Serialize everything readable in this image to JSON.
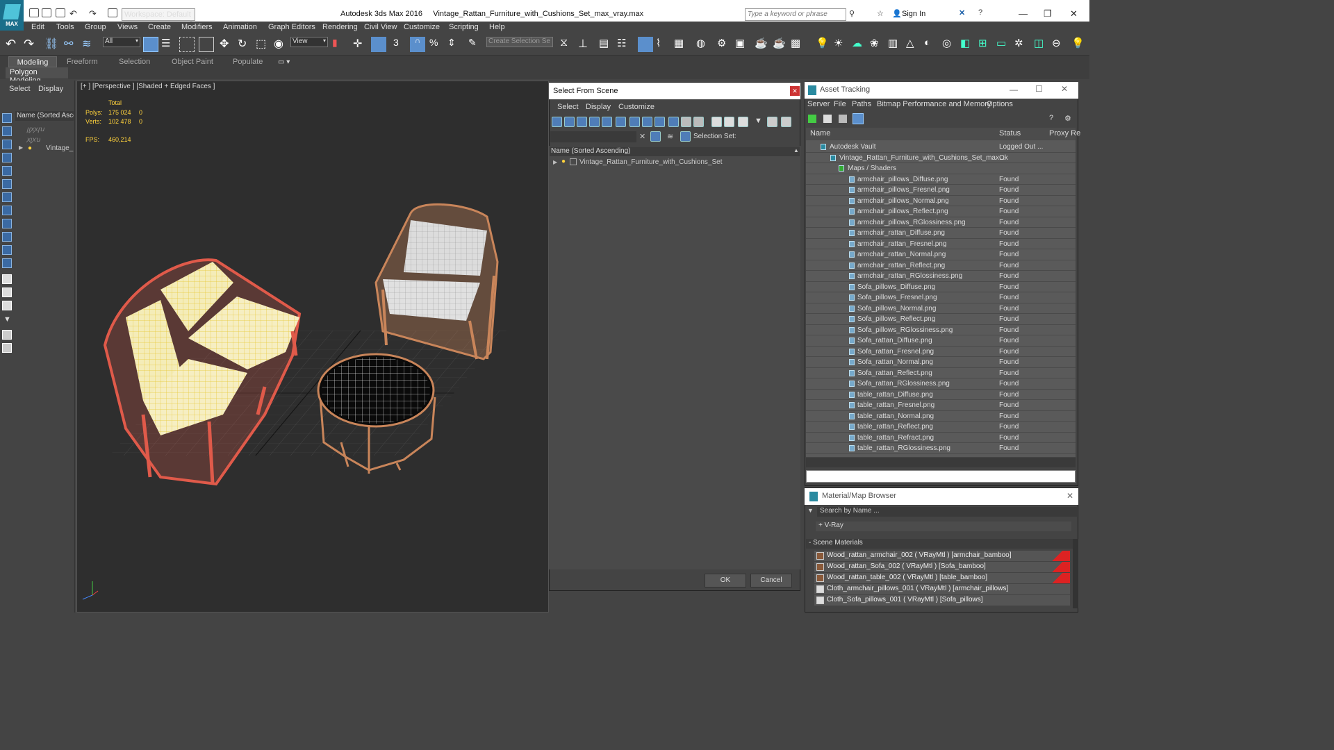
{
  "titlebar": {
    "logo": "MAX",
    "workspace": "Workspace: Default",
    "app_title": "Autodesk 3ds Max 2016     Vintage_Rattan_Furniture_with_Cushions_Set_max_vray.max",
    "search_placeholder": "Type a keyword or phrase",
    "sign_in": "Sign In"
  },
  "menu": [
    "Edit",
    "Tools",
    "Group",
    "Views",
    "Create",
    "Modifiers",
    "Animation",
    "Graph Editors",
    "Rendering",
    "Civil View",
    "Customize",
    "Scripting",
    "Help"
  ],
  "toolbar": {
    "filter": "All",
    "ref_coord": "View",
    "selection_set_placeholder": "Create Selection Se",
    "snap_3": "3"
  },
  "ribbon": {
    "tabs": [
      "Modeling",
      "Freeform",
      "Selection",
      "Object Paint",
      "Populate"
    ],
    "subtab": "Polygon Modeling"
  },
  "left_panel": {
    "tabs": [
      "Select",
      "Display"
    ],
    "header": "Name (Sorted Ascen",
    "rows": [
      "ꞁꞁꭗꭗꞁꭒ",
      "ꭗꞁꭗꭒ",
      "Vintage_R"
    ]
  },
  "viewport": {
    "label": "[+ ] [Perspective ] [Shaded + Edged Faces ]",
    "stats": {
      "total_label": "Total",
      "polys_label": "Polys:",
      "polys": "175 024",
      "polys_sel": "0",
      "verts_label": "Verts:",
      "verts": "102 478",
      "verts_sel": "0",
      "fps_label": "FPS:",
      "fps": "460,214"
    }
  },
  "select_from_scene": {
    "title": "Select From Scene",
    "menus": [
      "Select",
      "Display",
      "Customize"
    ],
    "selection_set": "Selection Set:",
    "header": "Name (Sorted Ascending)",
    "item": "Vintage_Rattan_Furniture_with_Cushions_Set",
    "ok": "OK",
    "cancel": "Cancel"
  },
  "asset_tracking": {
    "title": "Asset Tracking",
    "menus": [
      "Server",
      "File",
      "Paths",
      "Bitmap Performance and Memory",
      "Options"
    ],
    "columns": [
      "Name",
      "Status",
      "Proxy Re"
    ],
    "vault": {
      "name": "Autodesk Vault",
      "status": "Logged Out ..."
    },
    "file": {
      "name": "Vintage_Rattan_Furniture_with_Cushions_Set_max...",
      "status": "Ok"
    },
    "maps_folder": "Maps / Shaders",
    "maps": [
      {
        "name": "armchair_pillows_Diffuse.png",
        "status": "Found"
      },
      {
        "name": "armchair_pillows_Fresnel.png",
        "status": "Found"
      },
      {
        "name": "armchair_pillows_Normal.png",
        "status": "Found"
      },
      {
        "name": "armchair_pillows_Reflect.png",
        "status": "Found"
      },
      {
        "name": "armchair_pillows_RGlossiness.png",
        "status": "Found"
      },
      {
        "name": "armchair_rattan_Diffuse.png",
        "status": "Found"
      },
      {
        "name": "armchair_rattan_Fresnel.png",
        "status": "Found"
      },
      {
        "name": "armchair_rattan_Normal.png",
        "status": "Found"
      },
      {
        "name": "armchair_rattan_Reflect.png",
        "status": "Found"
      },
      {
        "name": "armchair_rattan_RGlossiness.png",
        "status": "Found"
      },
      {
        "name": "Sofa_pillows_Diffuse.png",
        "status": "Found"
      },
      {
        "name": "Sofa_pillows_Fresnel.png",
        "status": "Found"
      },
      {
        "name": "Sofa_pillows_Normal.png",
        "status": "Found"
      },
      {
        "name": "Sofa_pillows_Reflect.png",
        "status": "Found"
      },
      {
        "name": "Sofa_pillows_RGlossiness.png",
        "status": "Found"
      },
      {
        "name": "Sofa_rattan_Diffuse.png",
        "status": "Found"
      },
      {
        "name": "Sofa_rattan_Fresnel.png",
        "status": "Found"
      },
      {
        "name": "Sofa_rattan_Normal.png",
        "status": "Found"
      },
      {
        "name": "Sofa_rattan_Reflect.png",
        "status": "Found"
      },
      {
        "name": "Sofa_rattan_RGlossiness.png",
        "status": "Found"
      },
      {
        "name": "table_rattan_Diffuse.png",
        "status": "Found"
      },
      {
        "name": "table_rattan_Fresnel.png",
        "status": "Found"
      },
      {
        "name": "table_rattan_Normal.png",
        "status": "Found"
      },
      {
        "name": "table_rattan_Reflect.png",
        "status": "Found"
      },
      {
        "name": "table_rattan_Refract.png",
        "status": "Found"
      },
      {
        "name": "table_rattan_RGlossiness.png",
        "status": "Found"
      }
    ]
  },
  "material_browser": {
    "title": "Material/Map Browser",
    "search_placeholder": "Search by Name ...",
    "vray_group": "+ V-Ray",
    "scene_group": "- Scene Materials",
    "materials": [
      "Wood_rattan_armchair_002  ( VRayMtl ) [armchair_bamboo]",
      "Wood_rattan_Sofa_002  ( VRayMtl ) [Sofa_bamboo]",
      "Wood_rattan_table_002  ( VRayMtl ) [table_bamboo]",
      "Cloth_armchair_pillows_001  ( VRayMtl ) [armchair_pillows]",
      "Cloth_Sofa_pillows_001  ( VRayMtl ) [Sofa_pillows]"
    ]
  },
  "colors": {
    "ui_dark": "#444444",
    "viewport": "#2e2e2e",
    "stats_yellow": "#ffd23c",
    "sofa_selected": "#ffe86a",
    "sofa_frame": "#e05a4a",
    "rattan": "#c9855a"
  }
}
